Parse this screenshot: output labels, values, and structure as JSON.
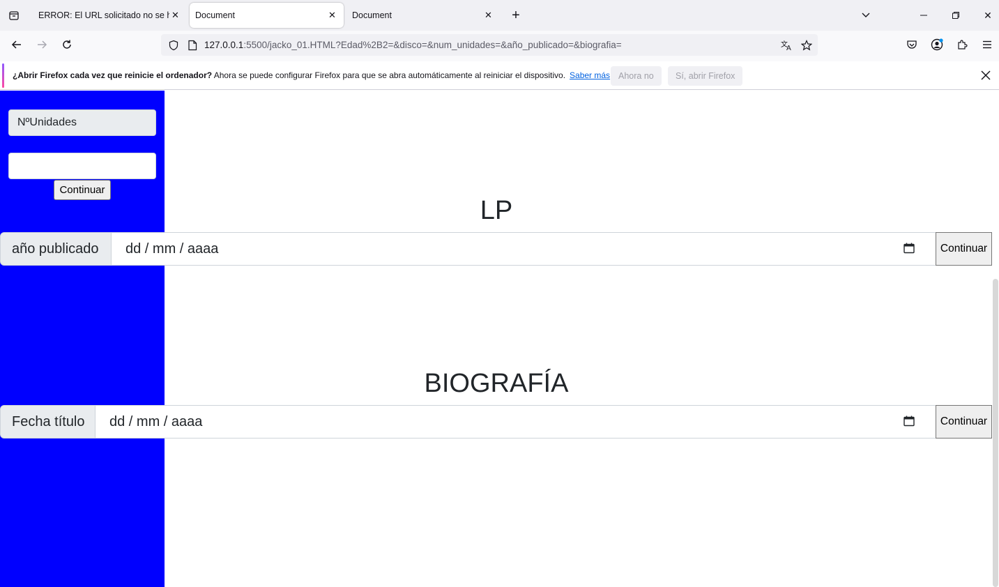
{
  "browser": {
    "tabs": [
      {
        "label": "ERROR: El URL solicitado no se ha p"
      },
      {
        "label": "Document"
      },
      {
        "label": "Document"
      }
    ],
    "url": {
      "host": "127.0.0.1",
      "rest": ":5500/jacko_01.HTML?Edad%2B2=&disco=&num_unidades=&año_publicado=&biografia="
    }
  },
  "notification": {
    "title": "¿Abrir Firefox cada vez que reinicie el ordenador?",
    "message": "Ahora se puede configurar Firefox para que se abra automáticamente al reiniciar el dispositivo.",
    "link": "Saber más",
    "dismiss_label": "Ahora no",
    "accept_label": "Sí, abrir Firefox"
  },
  "sidebar": {
    "label": "NºUnidades",
    "input_value": "",
    "button_label": "Continuar",
    "color": "#0000ff"
  },
  "sections": [
    {
      "heading": "LP",
      "addon": "año publicado",
      "placeholder": "dd / mm / aaaa",
      "button": "Continuar"
    },
    {
      "heading": "BIOGRAFÍA",
      "addon": "Fecha título",
      "placeholder": "dd / mm / aaaa",
      "button": "Continuar"
    }
  ]
}
